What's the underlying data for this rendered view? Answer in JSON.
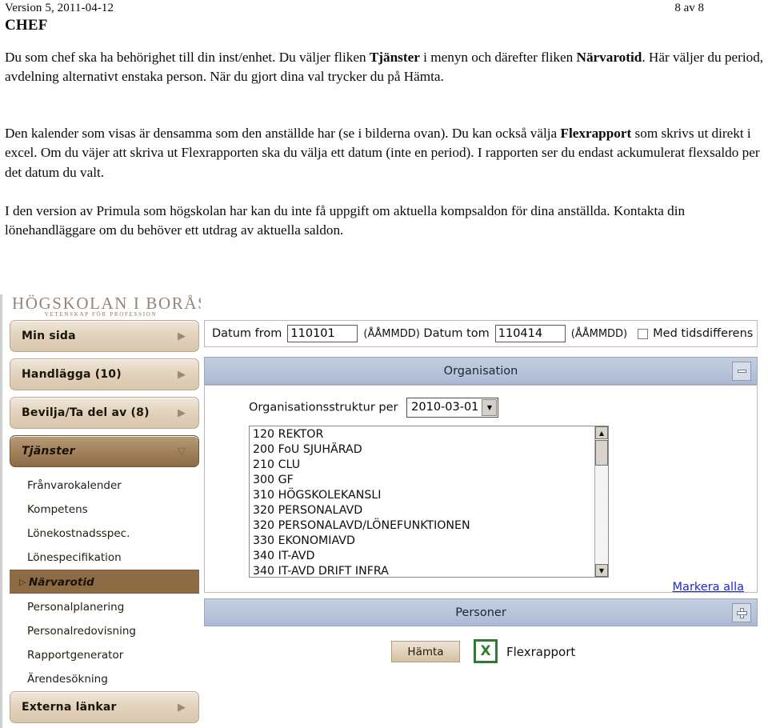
{
  "document": {
    "version_line": "Version 5, 2011-04-12",
    "page_number": "8 av 8",
    "title": "CHEF",
    "paragraphs": {
      "p1_a": "Du som chef ska ha behörighet till din inst/enhet. Du väljer fliken ",
      "p1_b": "Tjänster",
      "p1_c": " i menyn och därefter fliken ",
      "p1_d": "Närvarotid",
      "p1_e": ". Här väljer du period, avdelning alternativt enstaka person. När du gjort dina val trycker du på Hämta.",
      "p2_a": "Den kalender som visas är densamma som den anställde har (se i bilderna ovan). Du kan också välja ",
      "p2_b": "Flexrapport",
      "p2_c": " som skrivs ut direkt i excel. Om du väjer att skriva ut Flexrapporten ska du välja ett datum (inte en period). I rapporten ser du endast ackumulerat flexsaldo per det datum du valt.",
      "p3": "I den version av Primula som högskolan har kan du inte få uppgift om aktuella kompsaldon för dina anställda. Kontakta din lönehandläggare om du behöver ett utdrag av aktuella saldon."
    }
  },
  "app": {
    "logo": {
      "name": "HÖGSKOLAN I BORÅS",
      "tagline": "VETENSKAP FÖR PROFESSION"
    },
    "nav_buttons": [
      {
        "label": "Min sida",
        "caret": "▶"
      },
      {
        "label": "Handlägga (10)",
        "caret": "▶"
      },
      {
        "label": "Bevilja/Ta del av (8)",
        "caret": "▶"
      },
      {
        "label": "Tjänster",
        "caret": "▽"
      },
      {
        "label": "Externa länkar",
        "caret": "▶"
      }
    ],
    "nav_subitems": [
      {
        "label": "Frånvarokalender",
        "selected": false
      },
      {
        "label": "Kompetens",
        "selected": false
      },
      {
        "label": "Lönekostnadsspec.",
        "selected": false
      },
      {
        "label": "Lönespecifikation",
        "selected": false
      },
      {
        "label": "Närvarotid",
        "selected": true,
        "marker": "▷"
      },
      {
        "label": "Personalplanering",
        "selected": false
      },
      {
        "label": "Personalredovisning",
        "selected": false
      },
      {
        "label": "Rapportgenerator",
        "selected": false
      },
      {
        "label": "Ärendesökning",
        "selected": false
      }
    ],
    "date_bar": {
      "from_label": "Datum from",
      "from_value": "110101",
      "from_format": "(ÅÅMMDD)",
      "tom_label": "Datum tom",
      "tom_value": "110414",
      "tom_format": "(ÅÅMMDD)",
      "checkbox_label": "Med tidsdifferens",
      "checkbox_checked": false
    },
    "organisation_panel": {
      "title": "Organisation",
      "toggle": "minimize",
      "struct_label": "Organisationsstruktur per",
      "struct_value": "2010-03-01",
      "items": [
        "120 REKTOR",
        "200 FoU SJUHÄRAD",
        "210 CLU",
        "300 GF",
        "310 HÖGSKOLEKANSLI",
        "320 PERSONALAVD",
        "320 PERSONALAVD/LÖNEFUNKTIONEN",
        "330 EKONOMIAVD",
        "340 IT-AVD",
        "340 IT-AVD DRIFT INFRA"
      ],
      "select_all_link": "Markera alla"
    },
    "personer_panel": {
      "title": "Personer",
      "toggle": "expand"
    },
    "actions": {
      "fetch_button": "Hämta",
      "excel_glyph": "X",
      "flexrapport_label": "Flexrapport"
    },
    "colors": {
      "nav_button": "#e3d4bf",
      "nav_active": "#8c6b45",
      "panel_header": "#b7c4da",
      "link": "#2525c8",
      "excel_green": "#2f7a35"
    }
  }
}
